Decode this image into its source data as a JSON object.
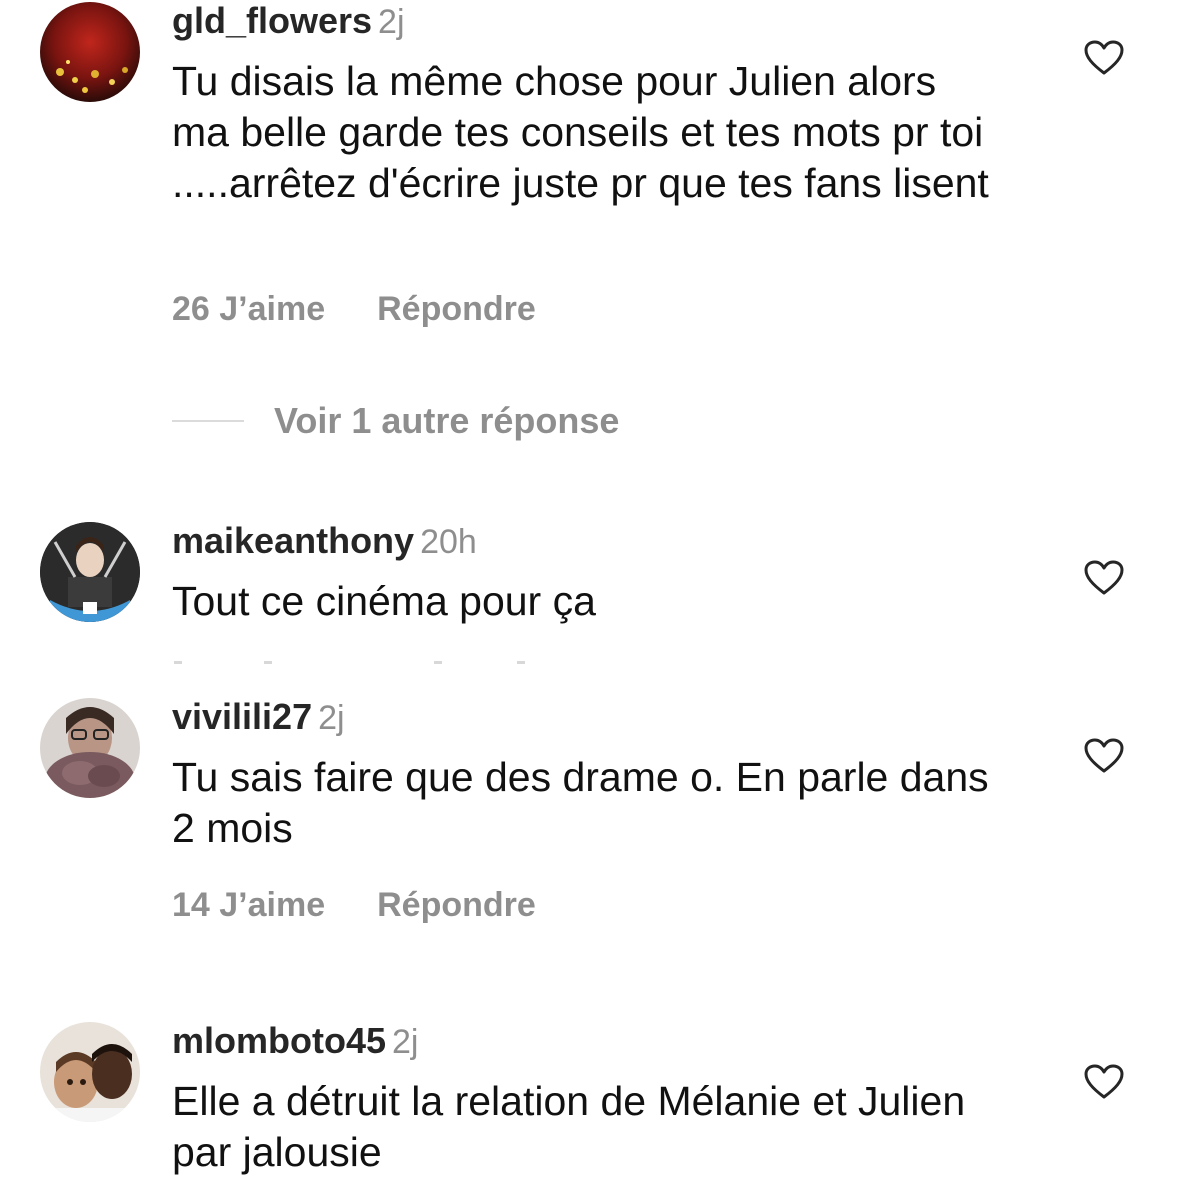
{
  "comments": [
    {
      "username": "gld_flowers",
      "time": "2j",
      "text": "Tu disais la même chose pour Julien alors ma belle garde tes conseils et tes mots pr toi .....arrêtez d'écrire juste pr que tes fans lisent",
      "likes": "26 J’aime",
      "reply": "Répondre"
    },
    {
      "username": "maikeanthony",
      "time": "20h",
      "text": "Tout ce cinéma pour ça"
    },
    {
      "username": "vivilili27",
      "time": "2j",
      "text": "Tu sais faire que des drame o. En parle dans 2 mois",
      "likes": "14 J’aime",
      "reply": "Répondre"
    },
    {
      "username": "mlomboto45",
      "time": "2j",
      "text": "Elle a détruit la relation de Mélanie et Julien par jalousie"
    }
  ],
  "view_more": "Voir 1 autre réponse",
  "icons": {
    "like": "heart-outline-icon"
  },
  "colors": {
    "username": "#262626",
    "secondary": "#8e8e8e",
    "divider": "#dbdbdb"
  }
}
